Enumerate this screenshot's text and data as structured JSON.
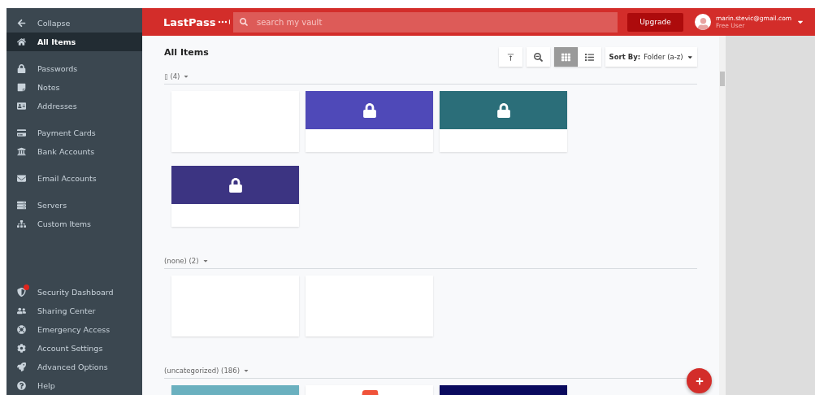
{
  "sidebar": {
    "collapse": {
      "label": "Collapse"
    },
    "items": [
      {
        "label": "All Items",
        "selected": true
      }
    ],
    "sections": [
      [
        {
          "label": "Passwords",
          "selected": false
        },
        {
          "label": "Notes",
          "selected": false
        },
        {
          "label": "Addresses",
          "selected": false
        }
      ],
      [
        {
          "label": "Payment Cards",
          "selected": false
        },
        {
          "label": "Bank Accounts",
          "selected": false
        }
      ],
      [
        {
          "label": "Email Accounts",
          "selected": false
        }
      ],
      [
        {
          "label": "Servers",
          "selected": false
        },
        {
          "label": "Custom Items",
          "selected": false
        }
      ]
    ],
    "bottom_items": [
      {
        "label": "Security Dashboard",
        "alert": true
      },
      {
        "label": "Sharing Center",
        "alert": false
      },
      {
        "label": "Emergency Access",
        "alert": false
      },
      {
        "label": "Account Settings",
        "alert": false
      },
      {
        "label": "Advanced Options",
        "alert": false
      },
      {
        "label": "Help",
        "alert": false
      }
    ]
  },
  "header": {
    "logo": "LastPass",
    "search": {
      "placeholder": "search my vault"
    },
    "upgrade": "Upgrade",
    "user": {
      "email": "marin.stevic@gmail.com",
      "plan": "Free User"
    }
  },
  "main": {
    "title": "All Items",
    "view": {
      "grid_selected": true
    },
    "sort": {
      "label": "Sort By:",
      "value": "Folder (a-z)"
    },
    "groups": [
      {
        "label": "▯ (4)",
        "items": [
          {
            "kind": "blank"
          },
          {
            "kind": "locked",
            "color": "#4f49b8"
          },
          {
            "kind": "locked",
            "color": "#2b6e79"
          },
          {
            "kind": "locked",
            "color": "#3c3482"
          }
        ]
      },
      {
        "label": "(none) (2)",
        "items": [
          {
            "kind": "blank"
          },
          {
            "kind": "blank"
          }
        ]
      },
      {
        "label": "(uncategorized) (186)",
        "items": [
          {
            "kind": "locked",
            "color": "#6ab0bf"
          },
          {
            "kind": "logo",
            "color": "#f0533a"
          },
          {
            "kind": "locked",
            "color": "#0a0a5e"
          }
        ]
      }
    ]
  }
}
